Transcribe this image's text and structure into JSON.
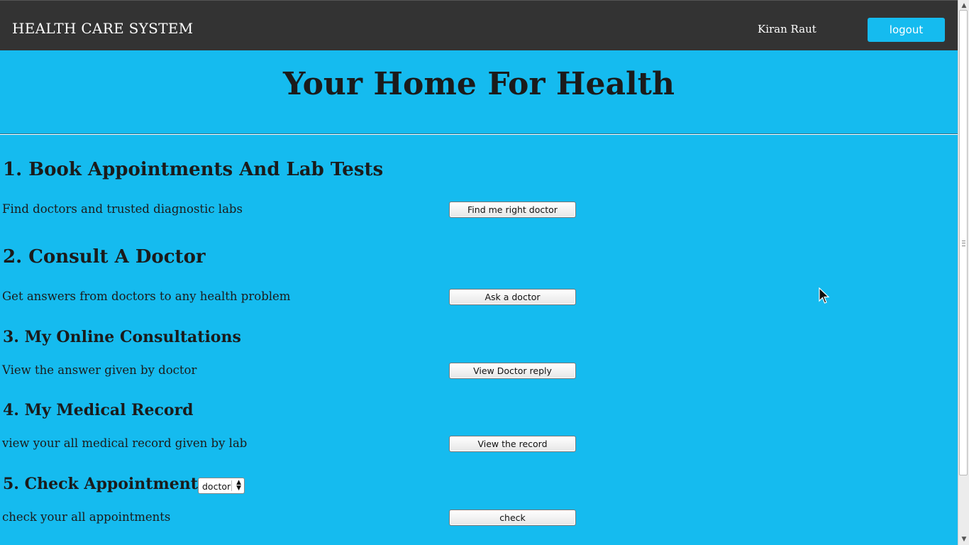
{
  "header": {
    "brand": "HEALTH CARE SYSTEM",
    "user_name": "Kiran Raut",
    "logout_label": "logout"
  },
  "hero": {
    "title": "Your Home For Health"
  },
  "sections": [
    {
      "heading": "1. Book Appointments And Lab Tests",
      "description": "Find doctors and trusted diagnostic labs",
      "button": "Find me right doctor"
    },
    {
      "heading": "2. Consult A Doctor",
      "description": "Get answers from doctors to any health problem",
      "button": "Ask a doctor"
    },
    {
      "heading": "3. My Online Consultations",
      "description": "View the answer given by doctor",
      "button": "View Doctor reply"
    },
    {
      "heading": "4. My Medical Record",
      "description": "view your all medical record given by lab",
      "button": "View the record"
    },
    {
      "heading": "5. Check Appointment",
      "description": "check your all appointments",
      "button": "check",
      "select_value": "doctor"
    }
  ],
  "colors": {
    "background": "#15bbef",
    "navbar": "#333333",
    "accent": "#15bbef"
  },
  "icons": {
    "select_arrows": "up-down-chevron-icon",
    "cursor": "mouse-pointer-icon"
  }
}
